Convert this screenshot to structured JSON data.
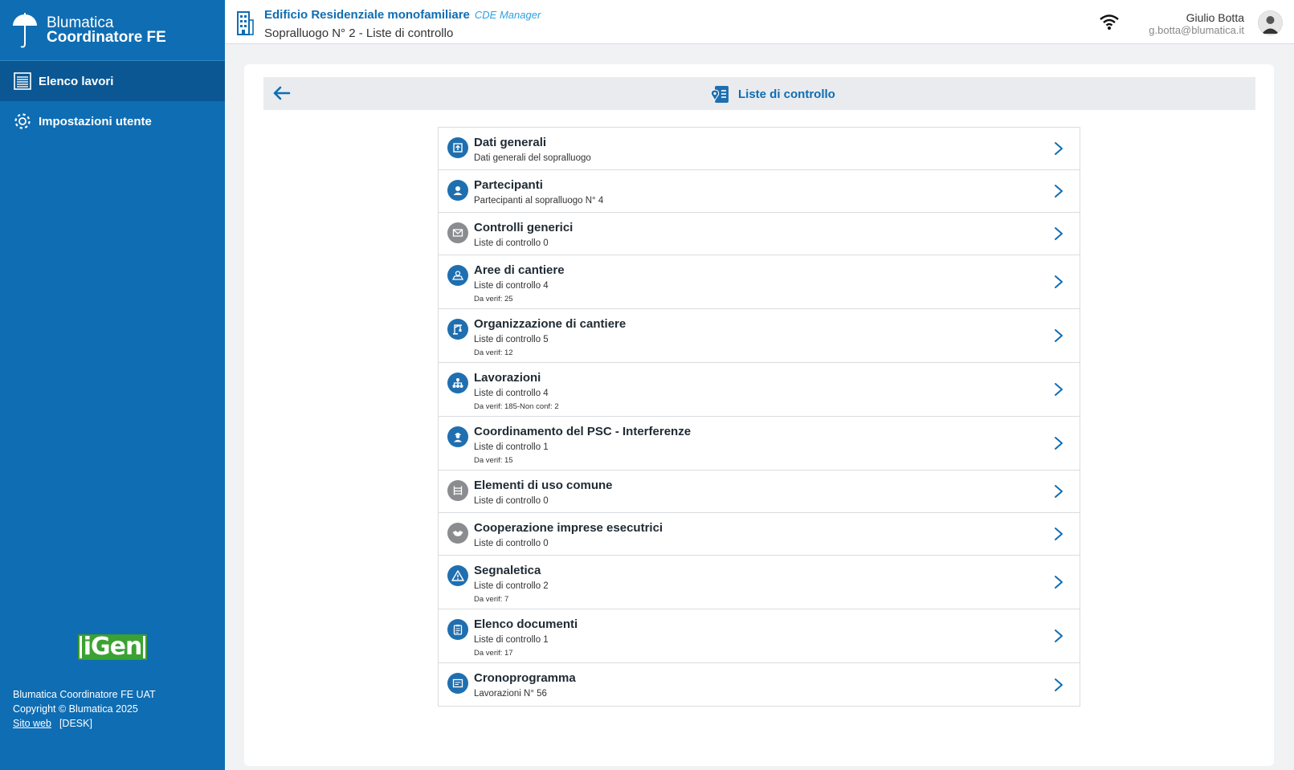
{
  "brand": {
    "line1": "Blumatica",
    "line2": "Coordinatore FE"
  },
  "sidebar": {
    "items": [
      {
        "label": "Elenco lavori",
        "icon": "list-icon"
      },
      {
        "label": "Impostazioni utente",
        "icon": "gear-icon"
      }
    ]
  },
  "igen_logo": "iGen",
  "footer": {
    "line1": "Blumatica Coordinatore FE UAT",
    "line2": "Copyright © Blumatica 2025",
    "link": "Sito web",
    "tag": "[DESK]"
  },
  "header": {
    "title": "Edificio Residenziale monofamiliare",
    "badge": "CDE Manager",
    "subtitle": "Sopralluogo N° 2 - Liste di controllo",
    "user_name": "Giulio Botta",
    "user_email": "g.botta@blumatica.it"
  },
  "section": {
    "title": "Liste di controllo"
  },
  "rows": [
    {
      "title": "Dati generali",
      "sub": "Dati generali del sopralluogo",
      "sub2": "",
      "icon": "upload-icon",
      "tone": "blue"
    },
    {
      "title": "Partecipanti",
      "sub": "Partecipanti al sopralluogo N° 4",
      "sub2": "",
      "icon": "person-icon",
      "tone": "blue"
    },
    {
      "title": "Controlli generici",
      "sub": "Liste di controllo 0",
      "sub2": "",
      "icon": "mail-check-icon",
      "tone": "grey"
    },
    {
      "title": "Aree di cantiere",
      "sub": "Liste di controllo 4",
      "sub2": "Da verif: 25",
      "icon": "area-icon",
      "tone": "blue"
    },
    {
      "title": "Organizzazione di cantiere",
      "sub": "Liste di controllo 5",
      "sub2": "Da verif: 12",
      "icon": "crane-icon",
      "tone": "blue"
    },
    {
      "title": "Lavorazioni",
      "sub": "Liste di controllo 4",
      "sub2": "Da verif: 185-Non conf: 2",
      "icon": "hierarchy-icon",
      "tone": "blue"
    },
    {
      "title": "Coordinamento del PSC - Interferenze",
      "sub": "Liste di controllo 1",
      "sub2": "Da verif: 15",
      "icon": "worker-icon",
      "tone": "blue"
    },
    {
      "title": "Elementi di uso comune",
      "sub": "Liste di controllo 0",
      "sub2": "",
      "icon": "scaffold-icon",
      "tone": "grey"
    },
    {
      "title": "Cooperazione imprese esecutrici",
      "sub": "Liste di controllo 0",
      "sub2": "",
      "icon": "handshake-icon",
      "tone": "grey"
    },
    {
      "title": "Segnaletica",
      "sub": "Liste di controllo 2",
      "sub2": "Da verif: 7",
      "icon": "warning-icon",
      "tone": "blue"
    },
    {
      "title": "Elenco documenti",
      "sub": "Liste di controllo 1",
      "sub2": "Da verif: 17",
      "icon": "clipboard-icon",
      "tone": "blue"
    },
    {
      "title": "Cronoprogramma",
      "sub": "Lavorazioni N° 56",
      "sub2": "",
      "icon": "calendar-icon",
      "tone": "blue"
    }
  ]
}
